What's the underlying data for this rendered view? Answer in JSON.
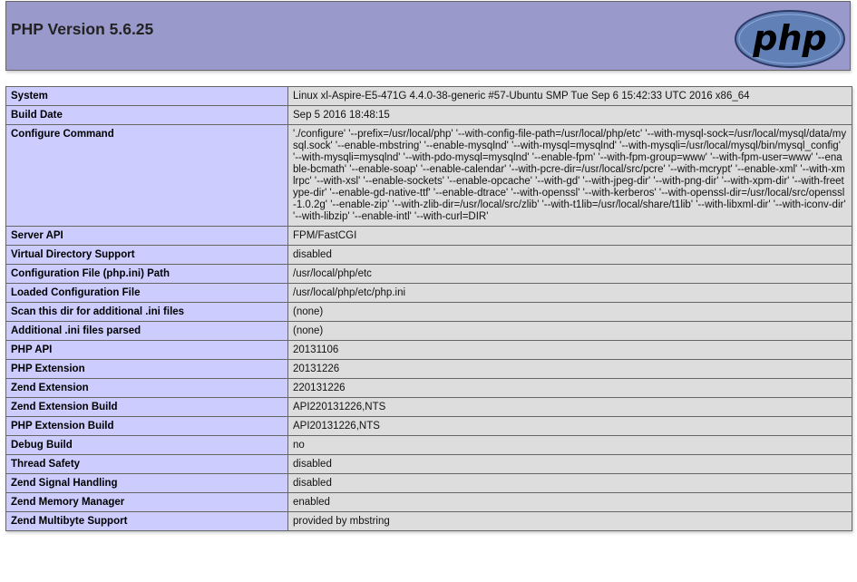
{
  "header": {
    "title": "PHP Version 5.6.25",
    "logo_text": "php"
  },
  "rows": [
    {
      "key": "System",
      "value": "Linux xl-Aspire-E5-471G 4.4.0-38-generic #57-Ubuntu SMP Tue Sep 6 15:42:33 UTC 2016 x86_64"
    },
    {
      "key": "Build Date",
      "value": "Sep 5 2016 18:48:15"
    },
    {
      "key": "Configure Command",
      "value": "'./configure' '--prefix=/usr/local/php' '--with-config-file-path=/usr/local/php/etc' '--with-mysql-sock=/usr/local/mysql/data/mysql.sock' '--enable-mbstring' '--enable-mysqlnd' '--with-mysql=mysqlnd' '--with-mysqli=/usr/local/mysql/bin/mysql_config' '--with-mysqli=mysqlnd' '--with-pdo-mysql=mysqlnd' '--enable-fpm' '--with-fpm-group=www' '--with-fpm-user=www' '--enable-bcmath' '--enable-soap' '--enable-calendar' '--with-pcre-dir=/usr/local/src/pcre' '--with-mcrypt' '--enable-xml' '--with-xmlrpc' '--with-xsl' '--enable-sockets' '--enable-opcache' '--with-gd' '--with-jpeg-dir' '--with-png-dir' '--with-xpm-dir' '--with-freetype-dir' '--enable-gd-native-ttf' '--enable-dtrace' '--with-openssl' '--with-kerberos' '--with-openssl-dir=/usr/local/src/openssl-1.0.2g' '--enable-zip' '--with-zlib-dir=/usr/local/src/zlib' '--with-t1lib=/usr/local/share/t1lib' '--with-libxml-dir' '--with-iconv-dir' '--with-libzip' '--enable-intl' '--with-curl=DIR'"
    },
    {
      "key": "Server API",
      "value": "FPM/FastCGI"
    },
    {
      "key": "Virtual Directory Support",
      "value": "disabled"
    },
    {
      "key": "Configuration File (php.ini) Path",
      "value": "/usr/local/php/etc"
    },
    {
      "key": "Loaded Configuration File",
      "value": "/usr/local/php/etc/php.ini"
    },
    {
      "key": "Scan this dir for additional .ini files",
      "value": "(none)"
    },
    {
      "key": "Additional .ini files parsed",
      "value": "(none)"
    },
    {
      "key": "PHP API",
      "value": "20131106"
    },
    {
      "key": "PHP Extension",
      "value": "20131226"
    },
    {
      "key": "Zend Extension",
      "value": "220131226"
    },
    {
      "key": "Zend Extension Build",
      "value": "API220131226,NTS"
    },
    {
      "key": "PHP Extension Build",
      "value": "API20131226,NTS"
    },
    {
      "key": "Debug Build",
      "value": "no"
    },
    {
      "key": "Thread Safety",
      "value": "disabled"
    },
    {
      "key": "Zend Signal Handling",
      "value": "disabled"
    },
    {
      "key": "Zend Memory Manager",
      "value": "enabled"
    },
    {
      "key": "Zend Multibyte Support",
      "value": "provided by mbstring"
    }
  ],
  "colors": {
    "header_bg": "#9999cc",
    "key_bg": "#ccccff",
    "value_bg": "#dddddd",
    "logo_fill": "#6181b6"
  }
}
